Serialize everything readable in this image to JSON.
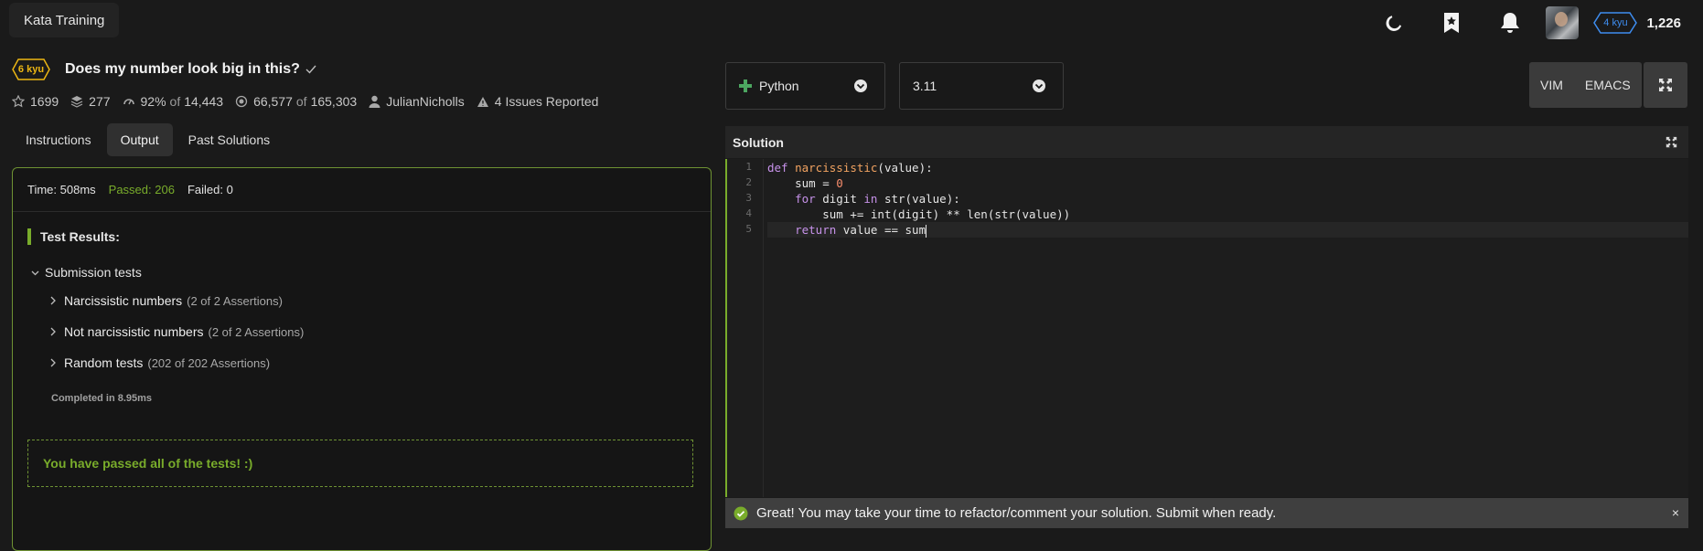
{
  "topbar": {
    "brand": "Kata Training",
    "icons": [
      "moon-icon",
      "bookmark-star-icon",
      "bell-icon"
    ],
    "user_rank": "4 kyu",
    "honor": "1,226",
    "rank_color": "#3e8df0"
  },
  "kata": {
    "rank": "6 kyu",
    "rank_color": "#ecb613",
    "title": "Does my number look big in this?",
    "stats": {
      "stars": "1699",
      "collections": "277",
      "satisfaction": "92%",
      "of_word": "of",
      "votes": "14,443",
      "completed": "66,577",
      "attempted": "165,303",
      "author": "JulianNicholls",
      "issues": "4 Issues Reported"
    }
  },
  "tabs": [
    "Instructions",
    "Output",
    "Past Solutions"
  ],
  "active_tab": "Output",
  "output": {
    "time": "Time: 508ms",
    "passed": "Passed: 206",
    "failed": "Failed: 0",
    "results_title": "Test Results:",
    "group": "Submission tests",
    "tests": [
      {
        "name": "Narcissistic numbers",
        "assertions": "(2 of 2 Assertions)"
      },
      {
        "name": "Not narcissistic numbers",
        "assertions": "(2 of 2 Assertions)"
      },
      {
        "name": "Random tests",
        "assertions": "(202 of 202 Assertions)"
      }
    ],
    "completed_in": "Completed in 8.95ms",
    "passed_message": "You have passed all of the tests! :)",
    "pass_color": "#79ac2b"
  },
  "editor": {
    "language": "Python",
    "version": "3.11",
    "modes": [
      "VIM",
      "EMACS"
    ],
    "panel_title": "Solution",
    "line_numbers": [
      "1",
      "2",
      "3",
      "4",
      "5"
    ],
    "code": {
      "l1": {
        "kw": "def",
        "fn": "narcissistic",
        "rest": "(value):"
      },
      "l2": {
        "indent": "    ",
        "pre": "sum = ",
        "num": "0"
      },
      "l3": {
        "indent": "    ",
        "kw1": "for",
        "mid": " digit ",
        "kw2": "in",
        "rest": " str(value):"
      },
      "l4": {
        "indent": "        ",
        "text": "sum += int(digit) ** len(str(value))"
      },
      "l5": {
        "indent": "    ",
        "kw": "return",
        "rest": " value == sum"
      }
    }
  },
  "toast": {
    "message": "Great! You may take your time to refactor/comment your solution. Submit when ready.",
    "close": "×"
  }
}
